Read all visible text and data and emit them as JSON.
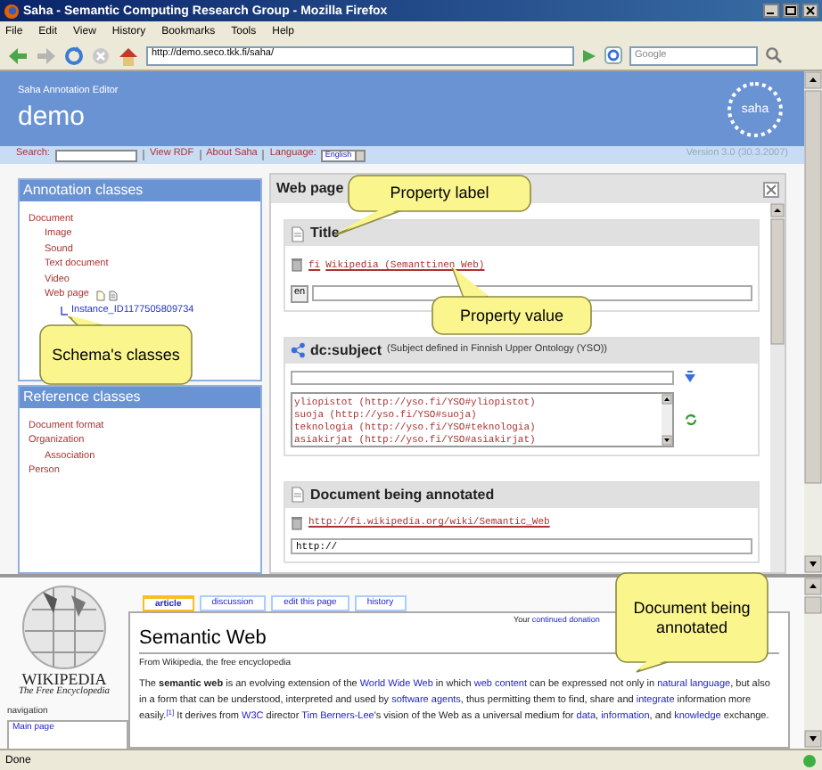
{
  "window": {
    "title": "Saha - Semantic Computing Research Group - Mozilla Firefox"
  },
  "menu": [
    "File",
    "Edit",
    "View",
    "History",
    "Bookmarks",
    "Tools",
    "Help"
  ],
  "toolbar": {
    "url": "http://demo.seco.tkk.fi/saha/",
    "search_placeholder": "Google"
  },
  "app": {
    "subtitle": "Saha Annotation Editor",
    "title": "demo",
    "logo": "saha"
  },
  "nav": {
    "search_label": "Search:",
    "links": [
      "View RDF",
      "About Saha"
    ],
    "language_label": "Language:",
    "language": "English",
    "version": "Version 3.0 (30.3.2007)"
  },
  "annotation_classes": {
    "title": "Annotation classes",
    "items": [
      {
        "label": "Document",
        "kind": "class",
        "actions": false,
        "children": [
          {
            "label": "Image",
            "kind": "class",
            "actions": false
          },
          {
            "label": "Sound",
            "kind": "class",
            "actions": false
          },
          {
            "label": "Text document",
            "kind": "class",
            "actions": false
          },
          {
            "label": "Video",
            "kind": "class",
            "actions": false
          },
          {
            "label": "Web page",
            "kind": "class",
            "actions": true,
            "children": [
              {
                "label": "Instance_ID1177505809734",
                "kind": "instance",
                "actions": false
              }
            ]
          }
        ]
      }
    ]
  },
  "reference_classes": {
    "title": "Reference classes",
    "items": [
      {
        "label": "Document format",
        "kind": "class",
        "actions": false
      },
      {
        "label": "Organization",
        "kind": "class",
        "actions": false,
        "children": [
          {
            "label": "Association",
            "kind": "class",
            "actions": false
          }
        ]
      },
      {
        "label": "Person",
        "kind": "class",
        "actions": false
      }
    ]
  },
  "editor": {
    "title": "Web page",
    "sections": [
      {
        "kind": "literal",
        "label": "Title",
        "values": [
          {
            "lang": "fi",
            "text": "Wikipedia (Semanttinen Web)"
          }
        ],
        "input_lang": "en"
      },
      {
        "kind": "multi_resource",
        "label": "dc:subject",
        "note": "(Subject defined in Finnish Upper Ontology (YSO))",
        "options": [
          "yliopistot (http://yso.fi/YSO#yliopistot)",
          "suoja (http://yso.fi/YSO#suoja)",
          "teknologia (http://yso.fi/YSO#teknologia)",
          "asiakirjat (http://yso.fi/YSO#asiakirjat)"
        ]
      },
      {
        "kind": "resource",
        "label": "Document being annotated",
        "values": [
          {
            "text": "http://fi.wikipedia.org/wiki/Semantic_Web"
          }
        ],
        "input_value": "http://"
      }
    ]
  },
  "wiki": {
    "logo_title": "WIKIPEDIA",
    "logo_tagline": "The Free Encyclopedia",
    "nav_heading": "navigation",
    "nav_items": [
      "Main page"
    ],
    "tabs": [
      {
        "label": "article",
        "selected": true
      },
      {
        "label": "discussion",
        "selected": false
      },
      {
        "label": "edit this page",
        "selected": false
      },
      {
        "label": "history",
        "selected": false
      }
    ],
    "notice_prefix": "Your",
    "notice_link": "continued donation",
    "heading": "Semantic Web",
    "tagline": "From Wikipedia, the free encyclopedia",
    "paragraph": [
      {
        "kind": "text",
        "text": "The "
      },
      {
        "kind": "bold",
        "text": "semantic web"
      },
      {
        "kind": "text",
        "text": " is an evolving extension of the "
      },
      {
        "kind": "link",
        "text": "World Wide Web"
      },
      {
        "kind": "text",
        "text": " in which "
      },
      {
        "kind": "link",
        "text": "web content"
      },
      {
        "kind": "text",
        "text": " can be expressed not only in "
      },
      {
        "kind": "link",
        "text": "natural language"
      },
      {
        "kind": "text",
        "text": ", but also in a form that can be understood, interpreted and used by "
      },
      {
        "kind": "link",
        "text": "software agents"
      },
      {
        "kind": "text",
        "text": ", thus permitting them to find, share and "
      },
      {
        "kind": "link",
        "text": "integrate"
      },
      {
        "kind": "text",
        "text": " information more easily."
      },
      {
        "kind": "ref",
        "text": "[1]"
      },
      {
        "kind": "text",
        "text": " It derives from "
      },
      {
        "kind": "link",
        "text": "W3C"
      },
      {
        "kind": "text",
        "text": " director "
      },
      {
        "kind": "link",
        "text": "Tim Berners-Lee"
      },
      {
        "kind": "text",
        "text": "'s vision of the Web as a universal medium for "
      },
      {
        "kind": "link",
        "text": "data"
      },
      {
        "kind": "text",
        "text": ", "
      },
      {
        "kind": "link",
        "text": "information"
      },
      {
        "kind": "text",
        "text": ", and "
      },
      {
        "kind": "link",
        "text": "knowledge"
      },
      {
        "kind": "text",
        "text": " exchange."
      }
    ]
  },
  "callouts": [
    {
      "text": "Property label"
    },
    {
      "text": "Property value"
    },
    {
      "text": "Schema's classes"
    },
    {
      "text": "Document being annotated"
    }
  ],
  "status_bar": {
    "text": "Done"
  }
}
